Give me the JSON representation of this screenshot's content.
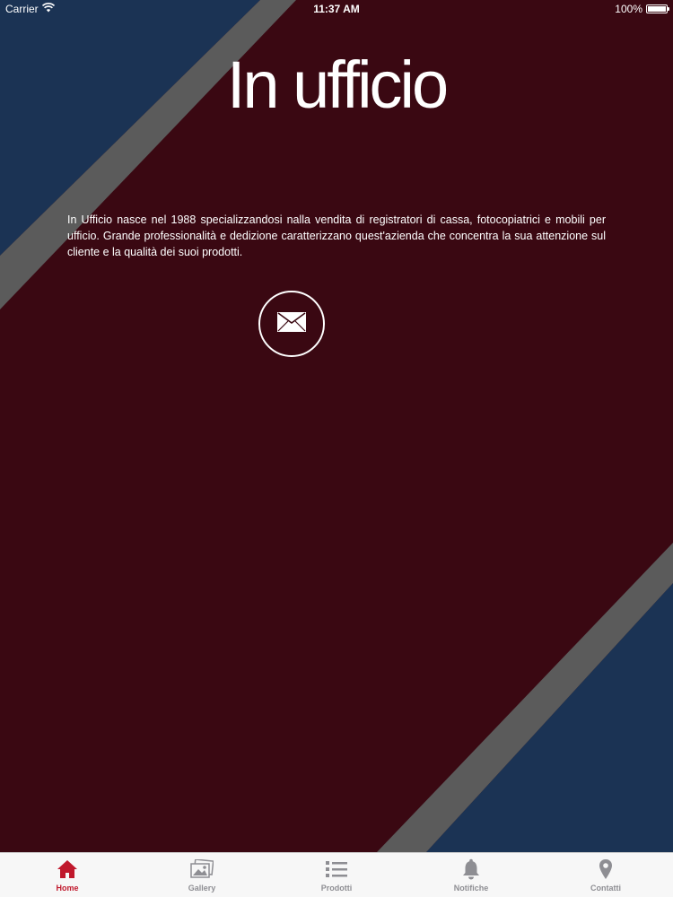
{
  "status_bar": {
    "carrier": "Carrier",
    "time": "11:37 AM",
    "battery": "100%",
    "battery_level": 1.0
  },
  "header": {
    "logo_text": "In ufficio"
  },
  "main": {
    "description": "In Ufficio nasce nel 1988 specializzandosi nalla vendita di registratori di cassa, fotocopiatrici e mobili per ufficio. Grande professionalità e dedizione caratterizzano quest'azienda che concentra la sua attenzione sul cliente e la qualità dei suoi prodotti.",
    "mail_icon": "envelope-icon"
  },
  "tab_bar": {
    "tabs": [
      {
        "label": "Home",
        "icon": "home-icon",
        "active": true
      },
      {
        "label": "Gallery",
        "icon": "gallery-icon",
        "active": false
      },
      {
        "label": "Prodotti",
        "icon": "list-icon",
        "active": false
      },
      {
        "label": "Notifiche",
        "icon": "bell-icon",
        "active": false
      },
      {
        "label": "Contatti",
        "icon": "location-pin-icon",
        "active": false
      }
    ]
  },
  "colors": {
    "background": "#3a0812",
    "navy": "#1b3354",
    "stripe": "#5b5b5b",
    "accent": "#c0182c",
    "inactive": "#8e8e93"
  }
}
